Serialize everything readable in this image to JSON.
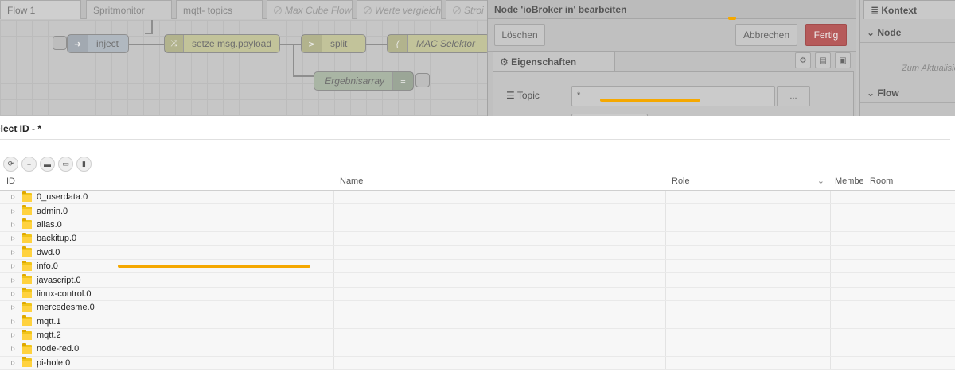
{
  "tabs": [
    {
      "label": "Flow 1",
      "active": true
    },
    {
      "label": "Spritmonitor"
    },
    {
      "label": "mqtt- topics"
    },
    {
      "label": "Max Cube Flow",
      "disabled": true
    },
    {
      "label": "Werte vergleiche",
      "disabled": true
    },
    {
      "label": "Stroi",
      "disabled": true
    }
  ],
  "flow": {
    "nodes": {
      "inject": "inject",
      "change": "setze msg.payload",
      "split": "split",
      "mac": "MAC Selektor",
      "debug": "Ergebnisarray"
    }
  },
  "edit_panel": {
    "title": "Node 'ioBroker in' bearbeiten",
    "delete_label": "Löschen",
    "cancel_label": "Abbrechen",
    "done_label": "Fertig",
    "properties_tab": "Eigenschaften",
    "topic_label": "Topic",
    "topic_value": "*",
    "browse_label": "..."
  },
  "sidebar": {
    "tab_label": "Kontext",
    "node_section": "Node",
    "refresh_hint": "Zum Aktualisie",
    "flow_section": "Flow"
  },
  "dialog": {
    "title": "elect ID - *",
    "columns": {
      "id": "ID",
      "name": "Name",
      "role": "Role",
      "members": "Membe",
      "room": "Room"
    },
    "rows": [
      "0_userdata.0",
      "admin.0",
      "alias.0",
      "backitup.0",
      "dwd.0",
      "info.0",
      "javascript.0",
      "linux-control.0",
      "mercedesme.0",
      "mqtt.1",
      "mqtt.2",
      "node-red.0",
      "pi-hole.0"
    ]
  },
  "colors": {
    "accent_orange": "#f5a800",
    "primary_button": "#b65a5a",
    "folder": "#f0c419"
  }
}
